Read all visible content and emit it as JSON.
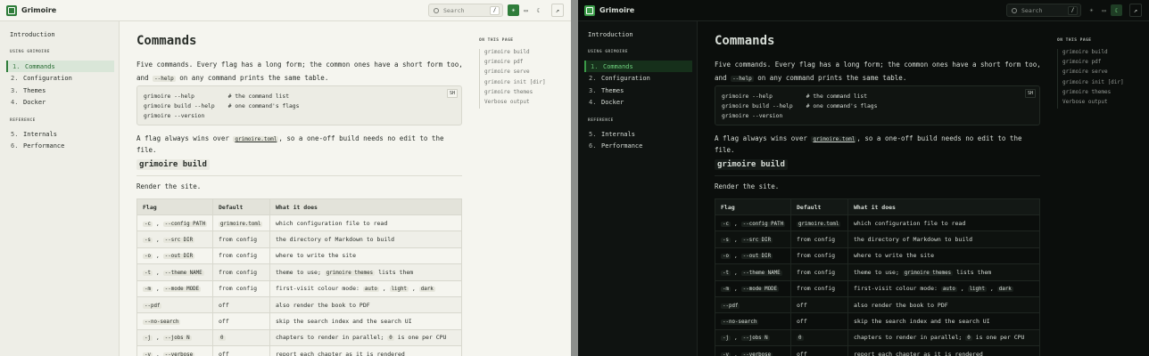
{
  "app": {
    "brand": "Grimoire"
  },
  "header": {
    "search_placeholder": "Search",
    "search_shortcut": "/",
    "theme_light_glyph": "☀",
    "theme_system_glyph": "▭",
    "theme_dark_glyph": "☾",
    "external_glyph": "↗"
  },
  "sidebar": {
    "intro": "Introduction",
    "sections": [
      {
        "title": "USING GRIMOIRE",
        "items": [
          {
            "num": "1.",
            "label": "Commands"
          },
          {
            "num": "2.",
            "label": "Configuration"
          },
          {
            "num": "3.",
            "label": "Themes"
          },
          {
            "num": "4.",
            "label": "Docker"
          }
        ]
      },
      {
        "title": "REFERENCE",
        "items": [
          {
            "num": "5.",
            "label": "Internals"
          },
          {
            "num": "6.",
            "label": "Performance"
          }
        ]
      }
    ]
  },
  "main": {
    "title": "Commands",
    "intro_text_a": "Five commands. Every flag has a long form; the common ones have a short form too, and",
    "intro_code": "--help",
    "intro_text_b": "on any command prints the same table.",
    "code_lang": "SH",
    "code_lines": [
      "grimoire --help          # the command list",
      "grimoire build --help    # one command's flags",
      "grimoire --version"
    ],
    "p2_a": "A flag always wins over",
    "p2_link": "grimoire.toml",
    "p2_b": ", so a one-off build needs no edit to the file.",
    "h2": "grimoire build",
    "p3": "Render the site.",
    "table_headers": [
      "Flag",
      "Default",
      "What it does"
    ],
    "table_rows": [
      {
        "flag_short": "-c",
        "flag_long": "--config PATH",
        "default": "grimoire.toml",
        "default_code": true,
        "desc_a": "which configuration file to read"
      },
      {
        "flag_short": "-s",
        "flag_long": "--src DIR",
        "default": "from config",
        "desc_a": "the directory of Markdown to build"
      },
      {
        "flag_short": "-o",
        "flag_long": "--out DIR",
        "default": "from config",
        "desc_a": "where to write the site"
      },
      {
        "flag_short": "-t",
        "flag_long": "--theme NAME",
        "default": "from config",
        "desc_a": "theme to use;",
        "desc_code": "grimoire themes",
        "desc_b": "lists them"
      },
      {
        "flag_short": "-m",
        "flag_long": "--mode MODE",
        "default": "from config",
        "desc_a": "first-visit colour mode:",
        "modes": [
          "auto",
          "light",
          "dark"
        ]
      },
      {
        "flag_short": "",
        "flag_long": "--pdf",
        "default": "off",
        "desc_a": "also render the book to PDF"
      },
      {
        "flag_short": "",
        "flag_long": "--no-search",
        "default": "off",
        "desc_a": "skip the search index and the search UI"
      },
      {
        "flag_short": "-j",
        "flag_long": "--jobs N",
        "default": "0",
        "default_code": true,
        "desc_a": "chapters to render in parallel;",
        "desc_code": "0",
        "desc_b": "is one per CPU"
      },
      {
        "flag_short": "-v",
        "flag_long": "--verbose",
        "default": "off",
        "desc_a": "report each chapter as it is rendered"
      }
    ]
  },
  "toc": {
    "title": "ON THIS PAGE",
    "items": [
      "grimoire build",
      "grimoire pdf",
      "grimoire serve",
      "grimoire init [dir]",
      "grimoire themes",
      "Verbose output"
    ]
  },
  "colors": {
    "accent_light": "#2f7d3a",
    "accent_dark": "#3a9a47"
  }
}
